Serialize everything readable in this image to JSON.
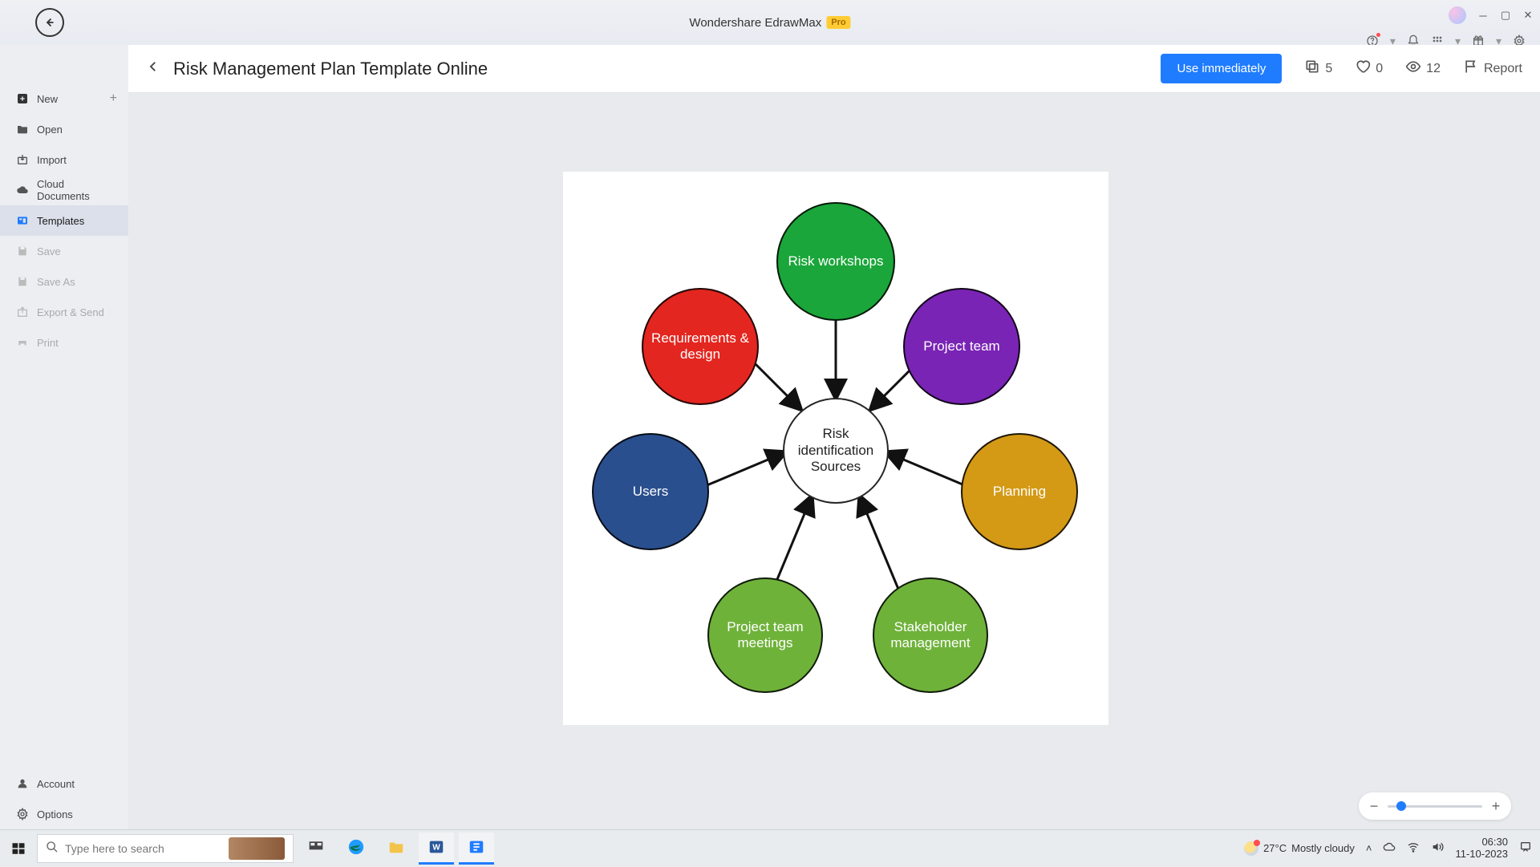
{
  "app": {
    "title": "Wondershare EdrawMax",
    "badge": "Pro"
  },
  "sidebar": {
    "new": "New",
    "open": "Open",
    "import": "Import",
    "cloud": "Cloud Documents",
    "templates": "Templates",
    "save": "Save",
    "saveas": "Save As",
    "export": "Export & Send",
    "print": "Print",
    "account": "Account",
    "options": "Options"
  },
  "header": {
    "title": "Risk Management Plan Template Online",
    "use_label": "Use immediately",
    "copies": "5",
    "likes": "0",
    "views": "12",
    "report": "Report"
  },
  "diagram": {
    "center": "Risk identification Sources",
    "nodes": {
      "risk_workshops": "Risk workshops",
      "requirements": "Requirements & design",
      "project_team": "Project team",
      "users": "Users",
      "planning": "Planning",
      "pt_meetings": "Project team meetings",
      "stakeholder": "Stakeholder management"
    },
    "colors": {
      "risk_workshops": "#1aa63a",
      "requirements": "#e3261f",
      "project_team": "#7a24b5",
      "users": "#2a4f8f",
      "planning": "#d49a16",
      "pt_meetings": "#6fb23a",
      "stakeholder": "#6fb23a",
      "center": "#ffffff"
    }
  },
  "taskbar": {
    "search_placeholder": "Type here to search",
    "weather_temp": "27°C",
    "weather_text": "Mostly cloudy",
    "time": "06:30",
    "date": "11-10-2023"
  }
}
